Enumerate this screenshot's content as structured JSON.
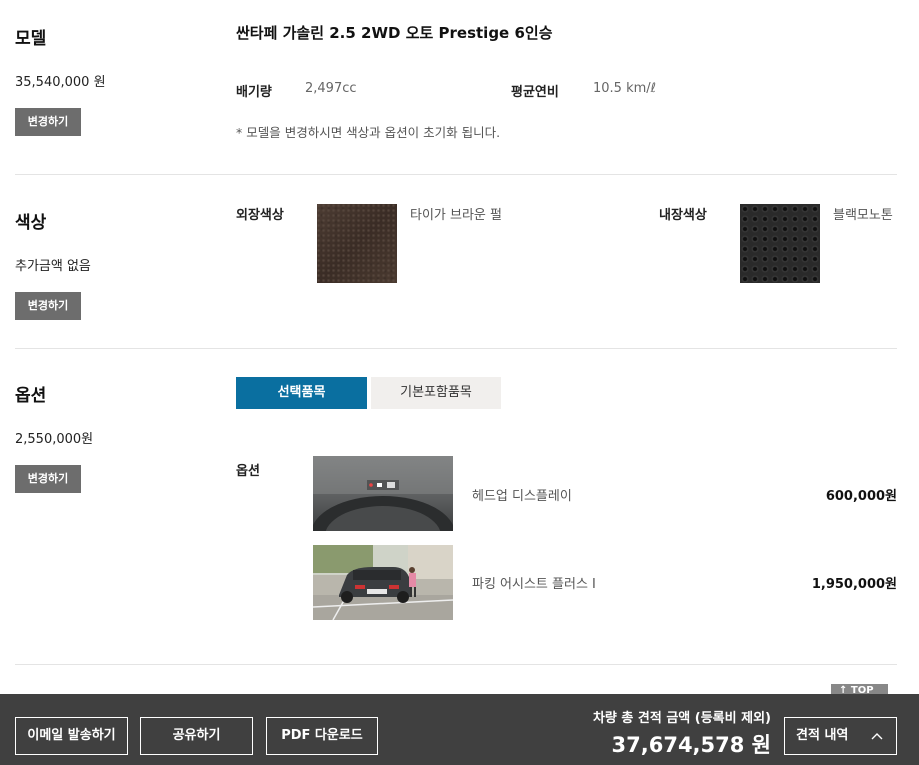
{
  "model": {
    "title": "모델",
    "price": "35,540,000 원",
    "change_label": "변경하기",
    "name": "싼타페 가솔린 2.5 2WD 오토 Prestige 6인승",
    "displacement_label": "배기량",
    "displacement_value": "2,497cc",
    "fuel_label": "평균연비",
    "fuel_value": "10.5 km/ℓ",
    "note": "* 모델을 변경하시면 색상과 옵션이 초기화 됩니다."
  },
  "color": {
    "title": "색상",
    "extra": "추가금액 없음",
    "change_label": "변경하기",
    "exterior_label": "외장색상",
    "exterior_name": "타이가 브라운 펄",
    "interior_label": "내장색상",
    "interior_name": "블랙모노톤",
    "exterior_hex": "#3f3129",
    "interior_hex": "#2a2a2a"
  },
  "options": {
    "title": "옵션",
    "price": "2,550,000원",
    "change_label": "변경하기",
    "tabs": [
      "선택품목",
      "기본포함품목"
    ],
    "active_tab": "선택품목",
    "list_label": "옵션",
    "items": [
      {
        "name": "헤드업 디스플레이",
        "price": "600,000원"
      },
      {
        "name": "파킹 어시스트 플러스 Ⅰ",
        "price": "1,950,000원"
      }
    ]
  },
  "top_button": "TOP",
  "footer": {
    "email_button": "이메일 발송하기",
    "share_button": "공유하기",
    "pdf_button": "PDF 다운로드",
    "total_label": "차량 총 견적 금액 (등록비 제외)",
    "total_value": "37,674,578 원",
    "estimate_button": "견적 내역"
  },
  "colors": {
    "accent": "#0a6fa0",
    "footer_bg": "#404040",
    "change_button_bg": "#6d6d6d"
  }
}
